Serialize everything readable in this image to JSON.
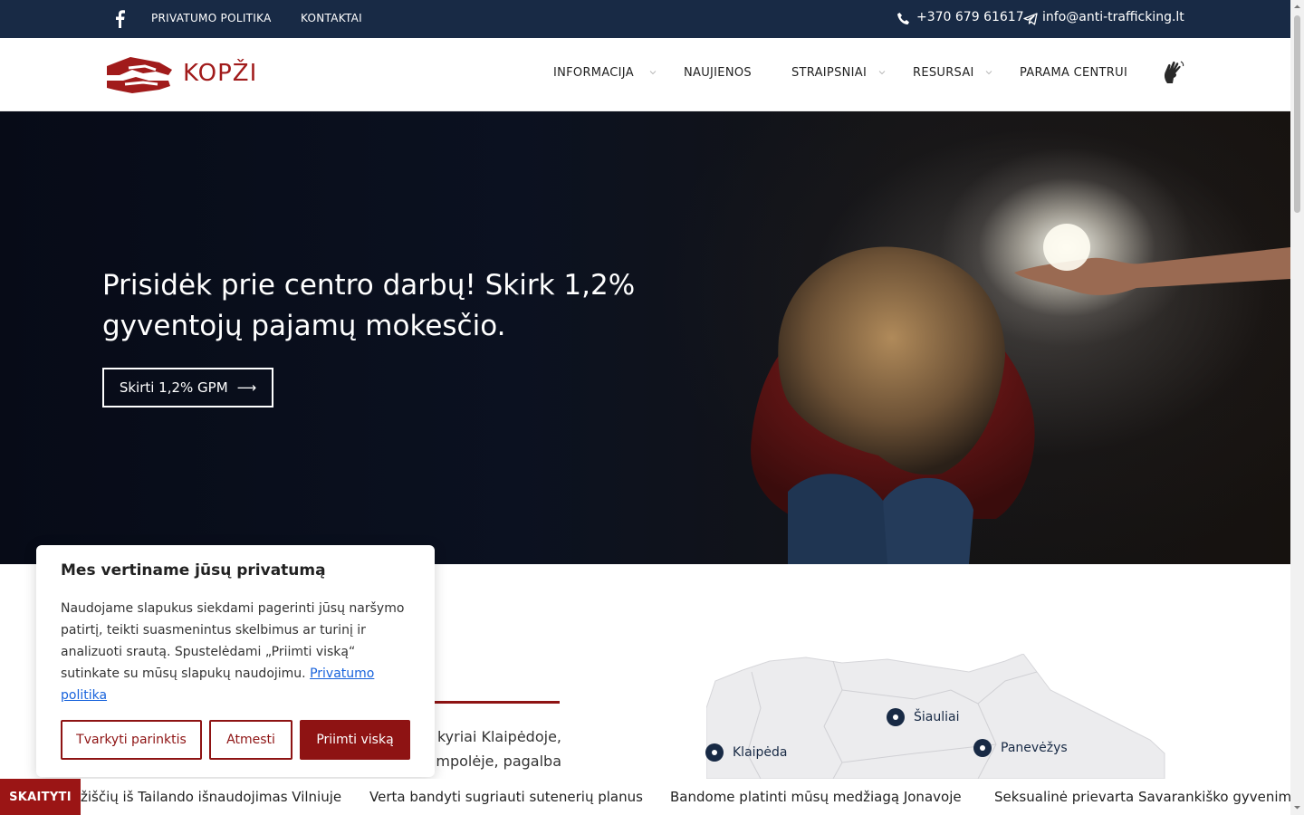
{
  "topbar": {
    "privacy_label": "PRIVATUMO POLITIKA",
    "contacts_label": "KONTAKTAI",
    "phone": "+370 679 61617",
    "email": "info@anti-trafficking.lt"
  },
  "header": {
    "logo_text": "KOPŽI",
    "nav": [
      {
        "label": "INFORMACIJA",
        "has_dropdown": true
      },
      {
        "label": "NAUJIENOS",
        "has_dropdown": false
      },
      {
        "label": "STRAIPSNIAI",
        "has_dropdown": true
      },
      {
        "label": "RESURSAI",
        "has_dropdown": true
      },
      {
        "label": "PARAMA CENTRUI",
        "has_dropdown": false
      }
    ]
  },
  "hero": {
    "title": "Prisidėk prie centro darbų! Skirk 1,2% gyventojų pajamų mokesčio.",
    "button_label": "Skirti 1,2% GPM",
    "arrow": "⟶"
  },
  "content": {
    "para_line1": "kyriai  Klaipėdoje,",
    "para_line2": "mpolėje,  pagalba"
  },
  "map": {
    "cities": [
      "Šiauliai",
      "Panevėžys",
      "Klaipėda"
    ]
  },
  "cookie": {
    "title": "Mes vertiname jūsų privatumą",
    "text": "Naudojame slapukus siekdami pagerinti jūsų naršymo patirtį, teikti suasmenintus skelbimus ar turinį ir analizuoti srautą. Spustelėdami „Priimti viską“ sutinkate su mūsų slapukų naudojimu.",
    "policy_link": "Privatumo politika",
    "btn_manage": "Tvarkyti parinktis",
    "btn_reject": "Atmesti",
    "btn_accept": "Priimti viską"
  },
  "ticker": {
    "label": "SKAITYTI",
    "items": [
      "žiščių iš Tailando išnaudojimas Vilniuje",
      "Verta bandyti sugriauti sutenerių planus",
      "Bandome platinti mūsų medžiagą Jonavoje",
      "Seksualinė prievarta Savarankiško gyvenimo"
    ]
  },
  "colors": {
    "topbar_bg": "#182a45",
    "brand_red": "#8e1313",
    "ticker_red": "#9b1515"
  }
}
